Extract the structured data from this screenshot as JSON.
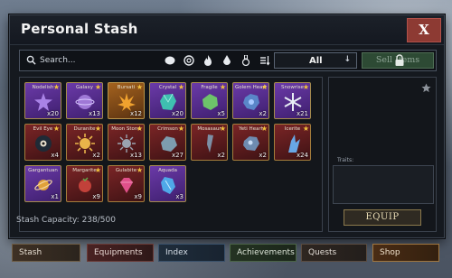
{
  "window": {
    "title": "Personal Stash",
    "close_label": "X"
  },
  "toolbar": {
    "search_placeholder": "Search...",
    "filter_icons": [
      "circle-icon",
      "spiral-icon",
      "flame-icon",
      "drop-icon",
      "flask-icon",
      "sort-icon",
      "collapse-icon"
    ],
    "filter_value": "All",
    "sell_label": "Sell Items"
  },
  "stash": {
    "items": [
      {
        "name": "Nodelish",
        "qty": "x20",
        "rarity": "purple",
        "star": true,
        "art": "star-crystal-icon",
        "color": "#a982e6"
      },
      {
        "name": "Galaxy",
        "qty": "x13",
        "rarity": "purple",
        "star": true,
        "art": "galaxy-orb-icon",
        "color": "#9f78d6"
      },
      {
        "name": "Bursati",
        "qty": "x12",
        "rarity": "gold",
        "star": true,
        "art": "fire-burst-icon",
        "color": "#f0a22e"
      },
      {
        "name": "Crystal",
        "qty": "x20",
        "rarity": "purple",
        "star": true,
        "art": "teal-crystal-icon",
        "color": "#3fbfb0"
      },
      {
        "name": "Fragile",
        "qty": "x5",
        "rarity": "purple",
        "star": true,
        "art": "green-shard-icon",
        "color": "#6dc36a"
      },
      {
        "name": "Golem Heart",
        "qty": "x2",
        "rarity": "purple",
        "star": true,
        "art": "golem-heart-icon",
        "color": "#5a86c9"
      },
      {
        "name": "Snowrise",
        "qty": "x21",
        "rarity": "purple",
        "star": true,
        "art": "snowflake-icon",
        "color": "#e8eef5"
      },
      {
        "name": "Evil Eye",
        "qty": "x4",
        "rarity": "red",
        "star": true,
        "art": "evil-eye-icon",
        "color": "#1f2a36"
      },
      {
        "name": "Duranite",
        "qty": "x2",
        "rarity": "red",
        "star": true,
        "art": "sun-gem-icon",
        "color": "#e9b44a"
      },
      {
        "name": "Moon Stone",
        "qty": "x13",
        "rarity": "red",
        "star": true,
        "art": "moon-stone-icon",
        "color": "#9aa3b0"
      },
      {
        "name": "Crimson",
        "qty": "x27",
        "rarity": "red",
        "star": true,
        "art": "crimson-rock-icon",
        "color": "#7d9cae"
      },
      {
        "name": "Mosasaur",
        "qty": "x2",
        "rarity": "red",
        "star": true,
        "art": "fang-icon",
        "color": "#7c8fa5"
      },
      {
        "name": "Yeti Heart",
        "qty": "x2",
        "rarity": "red",
        "star": true,
        "art": "yeti-heart-icon",
        "color": "#6e8bb0"
      },
      {
        "name": "Icerite",
        "qty": "x24",
        "rarity": "red",
        "star": true,
        "art": "ice-shard-icon",
        "color": "#68a7e6"
      },
      {
        "name": "Gargantuan",
        "qty": "x1",
        "rarity": "purple",
        "star": false,
        "art": "planet-icon",
        "color": "#e0a13a"
      },
      {
        "name": "Margarite",
        "qty": "x9",
        "rarity": "red",
        "star": true,
        "art": "red-berry-icon",
        "color": "#c2413a"
      },
      {
        "name": "Gulabite",
        "qty": "x9",
        "rarity": "red",
        "star": true,
        "art": "pink-gem-icon",
        "color": "#e0508a"
      },
      {
        "name": "Aquada",
        "qty": "x3",
        "rarity": "purple",
        "star": false,
        "art": "aqua-crystal-icon",
        "color": "#4fa8e8"
      }
    ],
    "capacity_text": "Stash Capacity: 238/500"
  },
  "detail": {
    "traits_label": "Traits:",
    "equip_label": "EQUIP"
  },
  "nav": {
    "stash": "Stash",
    "equipments": "Equipments",
    "index": "Index",
    "achievements": "Achievements",
    "quests": "Quests",
    "shop": "Shop"
  }
}
